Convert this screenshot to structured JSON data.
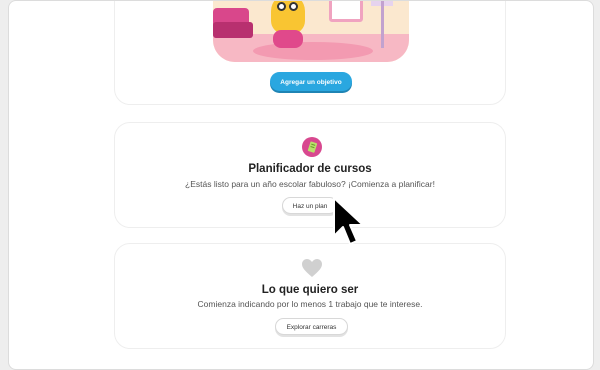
{
  "goal_card": {
    "button_label": "Agregar un objetivo"
  },
  "planner_card": {
    "icon": "planner-icon",
    "title": "Planificador de cursos",
    "subtitle": "¿Estás listo para un año escolar fabuloso? ¡Comienza a planificar!",
    "button_label": "Haz un plan"
  },
  "career_card": {
    "icon": "heart-icon",
    "title": "Lo que quiero ser",
    "subtitle": "Comienza indicando por lo menos 1 trabajo que te interese.",
    "button_label": "Explorar carreras"
  },
  "colors": {
    "primary_button": "#2aa7e0",
    "planner_icon": "#d8488f",
    "heart_icon": "#d0d0d0"
  }
}
